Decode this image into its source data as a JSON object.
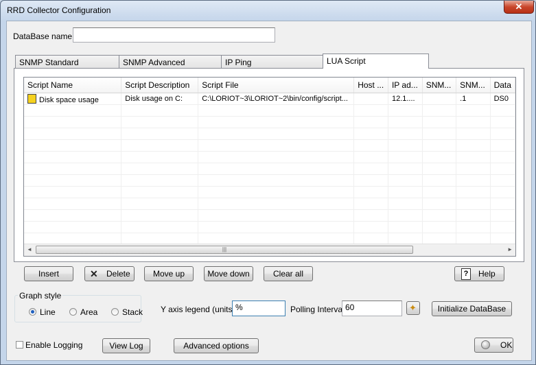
{
  "window": {
    "title": "RRD Collector Configuration",
    "close_glyph": "✕"
  },
  "database": {
    "label": "DataBase name",
    "value": ""
  },
  "tabs": [
    {
      "label": "SNMP Standard"
    },
    {
      "label": "SNMP Advanced"
    },
    {
      "label": "IP Ping"
    },
    {
      "label": "LUA Script",
      "active": true
    }
  ],
  "grid": {
    "columns": [
      "Script Name",
      "Script Description",
      "Script File",
      "Host ...",
      "IP ad...",
      "SNM...",
      "SNM...",
      "Data"
    ],
    "rows": [
      [
        "Disk space usage",
        "Disk usage on C:",
        "C:\\LORIOT~3\\LORIOT~2\\bin/config/script...",
        "",
        "12.1....",
        "",
        ".1",
        "DS0"
      ]
    ],
    "row_icon": "script-file-icon",
    "scroll_left": "◄",
    "scroll_right": "►",
    "scroll_grip": "|||"
  },
  "buttons": {
    "insert": "Insert",
    "delete": "Delete",
    "move_up": "Move up",
    "move_down": "Move down",
    "clear_all": "Clear all",
    "help": "Help",
    "initialize": "Initialize DataBase",
    "view_log": "View Log",
    "advanced": "Advanced options",
    "ok": "OK"
  },
  "graph_style": {
    "label": "Graph style",
    "options": [
      "Line",
      "Area",
      "Stack"
    ],
    "selected": "Line"
  },
  "y_axis": {
    "label": "Y axis legend (units)",
    "value": "%"
  },
  "polling": {
    "label": "Polling Interval",
    "value": "60"
  },
  "logging": {
    "label": "Enable Logging",
    "checked": false
  },
  "colors": {
    "accent": "#1f5fbf",
    "close": "#c9462c"
  }
}
